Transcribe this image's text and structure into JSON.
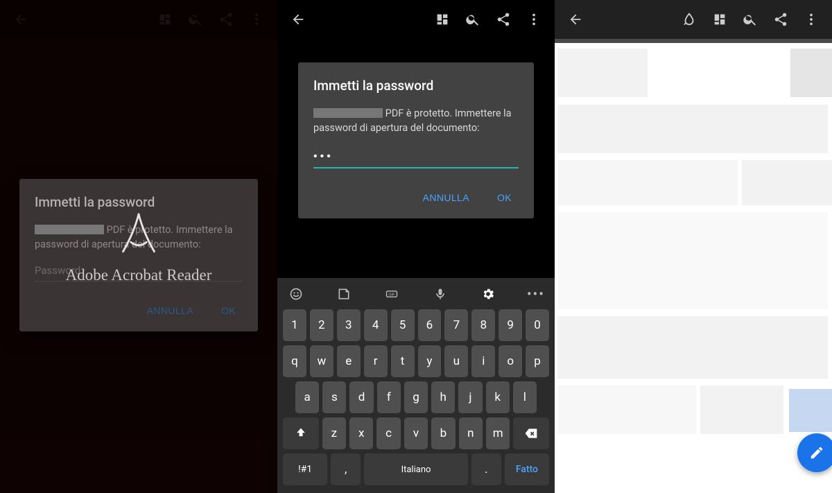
{
  "app_name": "Adobe Acrobat Reader",
  "dialog": {
    "title": "Immetti la password",
    "message_suffix": "PDF è protetto. Immettere la password di apertura del documento:",
    "placeholder": "Password",
    "masked_value": "•••",
    "cancel": "ANNULLA",
    "ok": "OK"
  },
  "keyboard": {
    "rows": [
      [
        "1",
        "2",
        "3",
        "4",
        "5",
        "6",
        "7",
        "8",
        "9",
        "0"
      ],
      [
        "q",
        "w",
        "e",
        "r",
        "t",
        "y",
        "u",
        "i",
        "o",
        "p"
      ],
      [
        "a",
        "s",
        "d",
        "f",
        "g",
        "h",
        "j",
        "k",
        "l"
      ],
      [
        "z",
        "x",
        "c",
        "v",
        "b",
        "n",
        "m"
      ]
    ],
    "symbols_key": "!#1",
    "comma": ",",
    "space_label": "Italiano",
    "period": ".",
    "done": "Fatto"
  },
  "icons": {
    "back": "back-icon",
    "page": "page-mode-icon",
    "search": "search-icon",
    "share": "share-icon",
    "overflow": "overflow-icon",
    "ink": "ink-icon",
    "edit": "edit-icon",
    "emoji": "emoji-icon",
    "sticker": "sticker-icon",
    "gif": "gif-icon",
    "mic": "mic-icon",
    "gear": "gear-icon"
  }
}
